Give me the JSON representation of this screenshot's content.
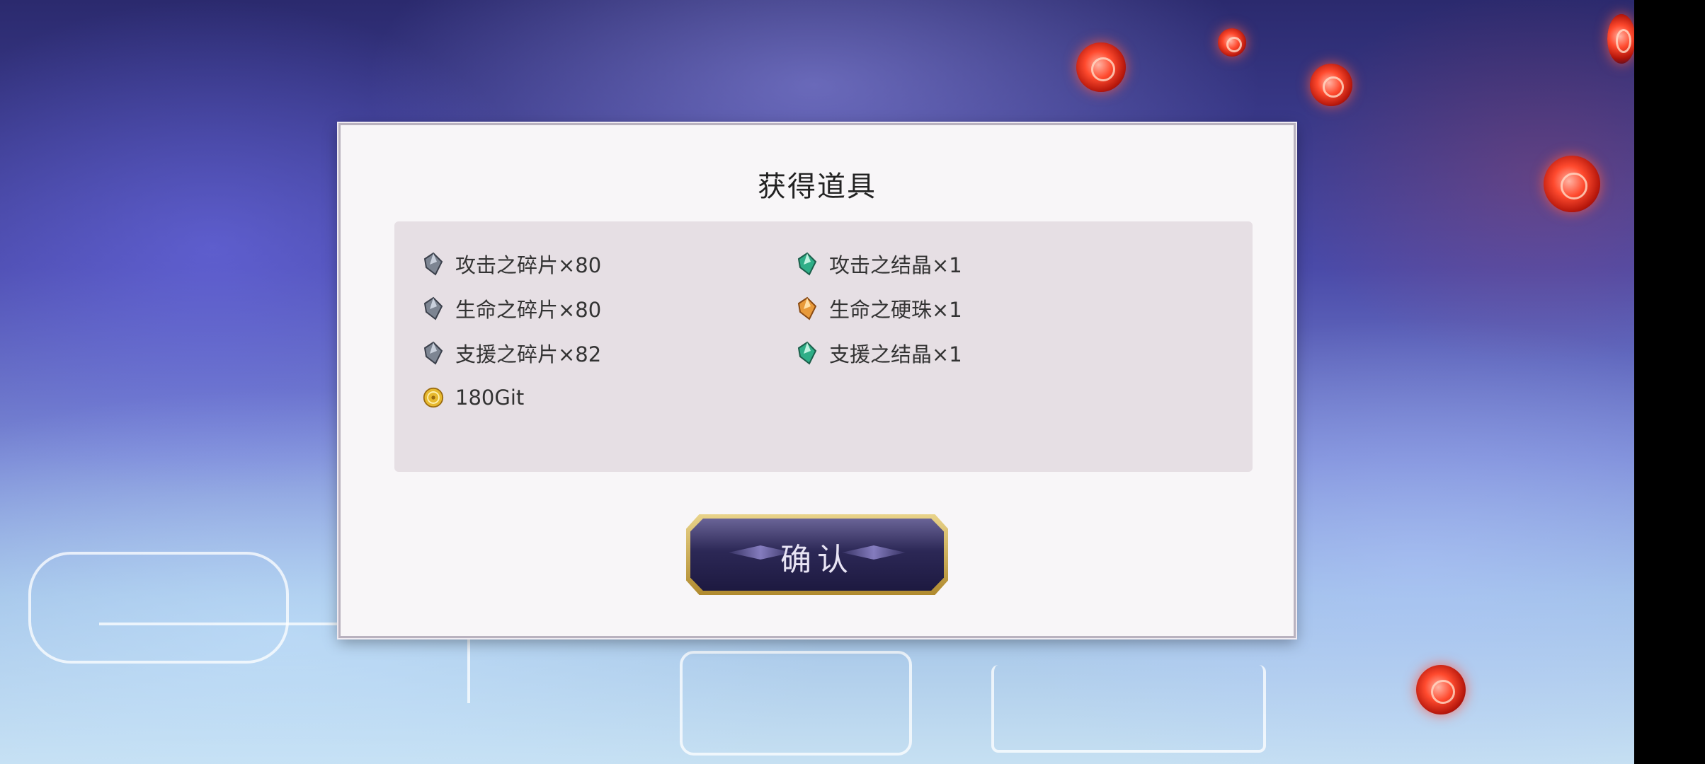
{
  "dialog": {
    "title": "获得道具",
    "items": [
      {
        "label": "攻击之碎片×80",
        "icon": "shard-gray-icon"
      },
      {
        "label": "攻击之结晶×1",
        "icon": "crystal-green-icon"
      },
      {
        "label": "生命之碎片×80",
        "icon": "shard-gray-icon"
      },
      {
        "label": "生命之硬珠×1",
        "icon": "gem-orange-icon"
      },
      {
        "label": "支援之碎片×82",
        "icon": "shard-gray-icon"
      },
      {
        "label": "支援之结晶×1",
        "icon": "crystal-green-icon"
      },
      {
        "label": "180Git",
        "icon": "gold-coin-icon"
      }
    ],
    "confirm_label": "确认"
  },
  "colors": {
    "panel_bg": "#e6dfe4",
    "button_gold": "#c9a64a",
    "button_purple": "#2c2856"
  }
}
